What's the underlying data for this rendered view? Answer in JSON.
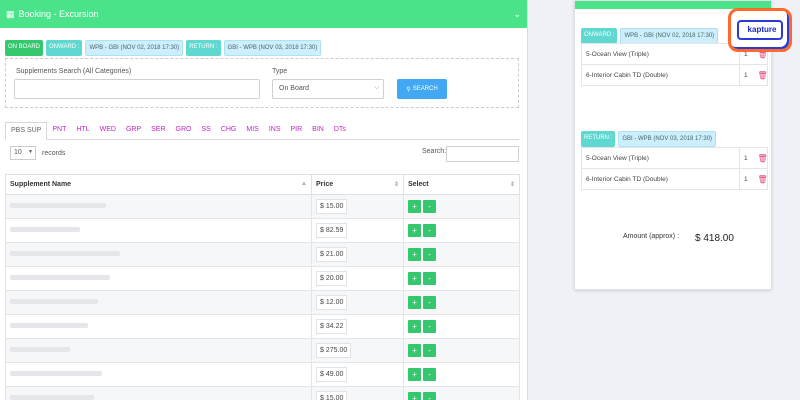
{
  "header": {
    "title": "Booking - Excursion"
  },
  "tags": {
    "on_board": "ON BOARD",
    "onward_label": "ONWARD :",
    "onward_value": "WPB - GBI (NOV 02, 2018 17:30)",
    "return_label": "RETURN :",
    "return_value": "GBI - WPB (NOV 03, 2018 17:30)"
  },
  "search": {
    "label": "Supplements Search (All Categories)",
    "type_label": "Type",
    "type_value": "On Board",
    "button": "SEARCH"
  },
  "tabs": [
    "PBS SUP",
    "PNT",
    "HTL",
    "WED",
    "GRP",
    "SER",
    "GRO",
    "SS",
    "CHG",
    "MIS",
    "INS",
    "PIR",
    "BIN",
    "DTs"
  ],
  "records": {
    "count": "10",
    "label": "records",
    "search_label": "Search:"
  },
  "table": {
    "headers": [
      "Supplement Name",
      "Price",
      "Select"
    ],
    "rows": [
      {
        "price": "$ 15.00"
      },
      {
        "price": "$ 82.59"
      },
      {
        "price": "$ 21.00"
      },
      {
        "price": "$ 20.00"
      },
      {
        "price": "$ 12.00"
      },
      {
        "price": "$ 34.22"
      },
      {
        "price": "$ 275.00"
      },
      {
        "price": "$ 49.00"
      },
      {
        "price": "$ 15.00"
      }
    ]
  },
  "details": {
    "onward_label": "ONWARD :",
    "onward_value": "WPB - GBI (NOV 02, 2018 17:30)",
    "return_label": "RETURN :",
    "return_value": "GBI - WPB (NOV 03, 2018 17:30)",
    "onward_items": [
      {
        "name": "5-Ocean View (Triple)",
        "qty": "1"
      },
      {
        "name": "6-Interior Cabin TD (Double)",
        "qty": "1"
      }
    ],
    "return_items": [
      {
        "name": "5-Ocean View (Triple)",
        "qty": "1"
      },
      {
        "name": "6-Interior Cabin TD (Double)",
        "qty": "1"
      }
    ],
    "amount_label": "Amount (approx) :",
    "amount_value": "$ 418.00"
  },
  "logo": {
    "text": "kapture"
  }
}
